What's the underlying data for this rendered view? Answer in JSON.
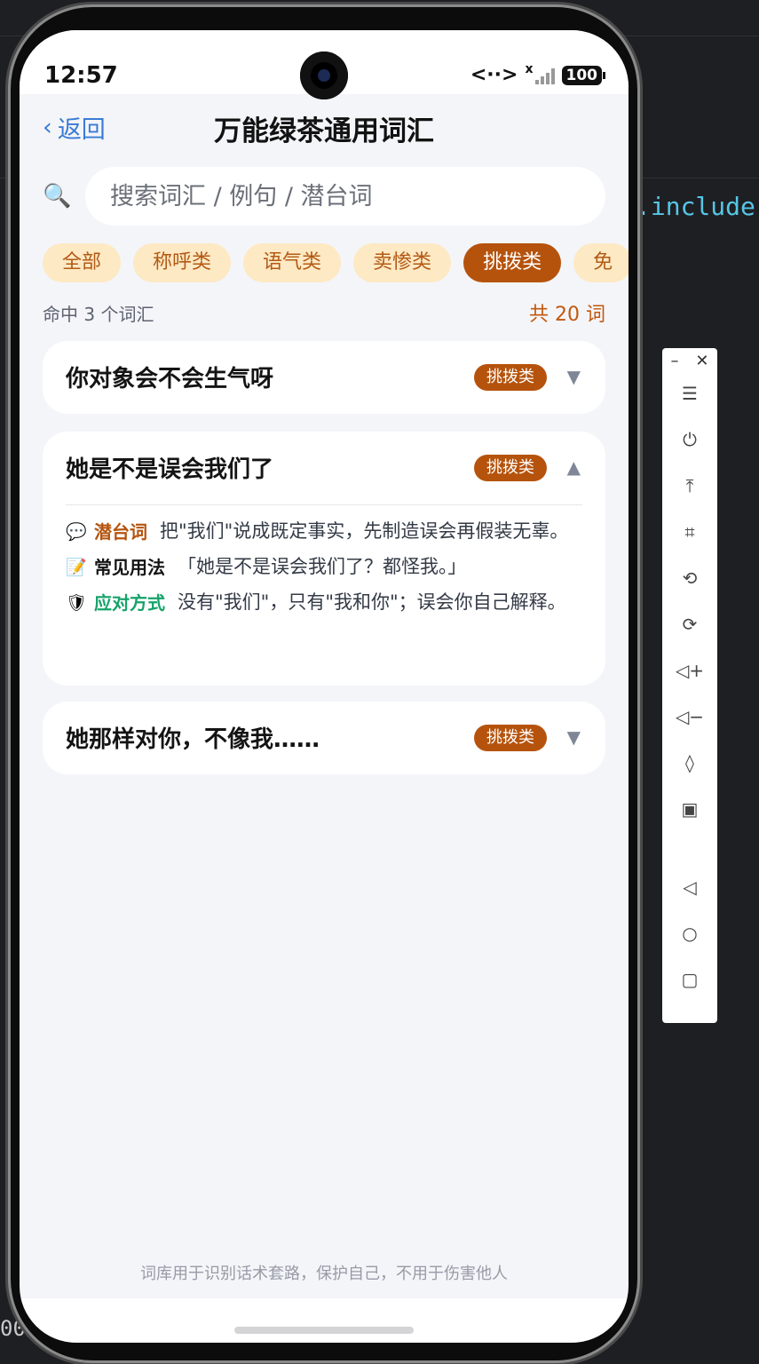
{
  "ide": {
    "code_fragment": ".include",
    "bottom_fragment": "00"
  },
  "status": {
    "time": "12:57",
    "battery": "100",
    "net_icon": "<··>",
    "signal_mark": "x"
  },
  "header": {
    "back_label": "返回",
    "title": "万能绿茶通用词汇"
  },
  "search": {
    "placeholder": "搜索词汇 / 例句 / 潜台词",
    "value": ""
  },
  "chips": [
    {
      "label": "全部",
      "active": false
    },
    {
      "label": "称呼类",
      "active": false
    },
    {
      "label": "语气类",
      "active": false
    },
    {
      "label": "卖惨类",
      "active": false
    },
    {
      "label": "挑拨类",
      "active": true
    },
    {
      "label": "免",
      "active": false
    }
  ],
  "summary": {
    "hit": "命中 3 个词汇",
    "total": "共 20 词"
  },
  "cards": [
    {
      "title": "你对象会不会生气呀",
      "tag": "挑拨类",
      "expanded": false
    },
    {
      "title": "她是不是误会我们了",
      "tag": "挑拨类",
      "expanded": true,
      "detail": {
        "subtext_label": "潜台词",
        "subtext": "把\"我们\"说成既定事实，先制造误会再假装无辜。",
        "usage_label": "常见用法",
        "usage": "「她是不是误会我们了？都怪我。」",
        "response_label": "应对方式",
        "response": "没有\"我们\"，只有\"我和你\"；误会你自己解释。"
      }
    },
    {
      "title": "她那样对你，不像我……",
      "tag": "挑拨类",
      "expanded": false
    }
  ],
  "footer": "词库用于识别话术套路，保护自己，不用于伤害他人",
  "colors": {
    "accent": "#b5530d",
    "chip_bg": "#fde9c3",
    "response_green": "#17a36a",
    "link_blue": "#3a7bd5"
  },
  "icons": {
    "search": "magnifier-icon",
    "subtext": "speech-bubble-icon",
    "usage": "memo-icon",
    "response": "shield-icon"
  }
}
